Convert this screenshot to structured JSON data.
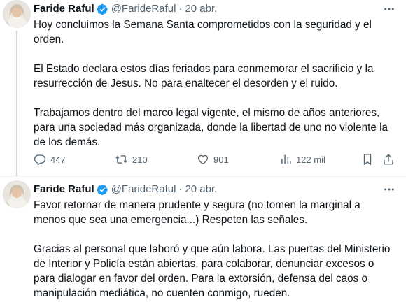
{
  "tweets": [
    {
      "author": {
        "name": "Faride Raful",
        "handle": "@FarideRaful"
      },
      "date": "20 abr.",
      "separator": "·",
      "paragraphs": [
        "Hoy concluimos la Semana Santa comprometidos con la seguridad y el orden.",
        "El Estado declara estos días feriados para conmemorar el sacrificio y la resurrección de Jesus. No para enaltecer el desorden y el ruido.",
        "Trabajamos dentro del marco legal vigente, el mismo de años anteriores, para una sociedad más organizada, donde la libertad de uno no violente la de los demás."
      ],
      "metrics": {
        "replies": "447",
        "reposts": "210",
        "likes": "901",
        "views": "122 mil"
      }
    },
    {
      "author": {
        "name": "Faride Raful",
        "handle": "@FarideRaful"
      },
      "date": "20 abr.",
      "separator": "·",
      "paragraphs": [
        "Favor retornar de manera prudente y segura (no tomen la marginal a menos que sea una emergencia...) Respeten las señales.",
        "Gracias al personal que laboró y que aún labora. Las puertas del Ministerio de Interior y Policía están abiertas, para colaborar, denunciar excesos o para dialogar en favor del orden. Para la extorsión, defensa del caos o manipulación mediática, no cuenten conmigo, rueden."
      ]
    }
  ],
  "colors": {
    "text": "#0f1419",
    "secondary": "#536471",
    "verified": "#1d9bf0",
    "divider": "#eff3f4",
    "thread": "#cfd9de"
  },
  "icons": [
    "more-icon",
    "verified-badge-icon",
    "reply-icon",
    "repost-icon",
    "like-icon",
    "views-icon",
    "bookmark-icon",
    "share-icon"
  ]
}
